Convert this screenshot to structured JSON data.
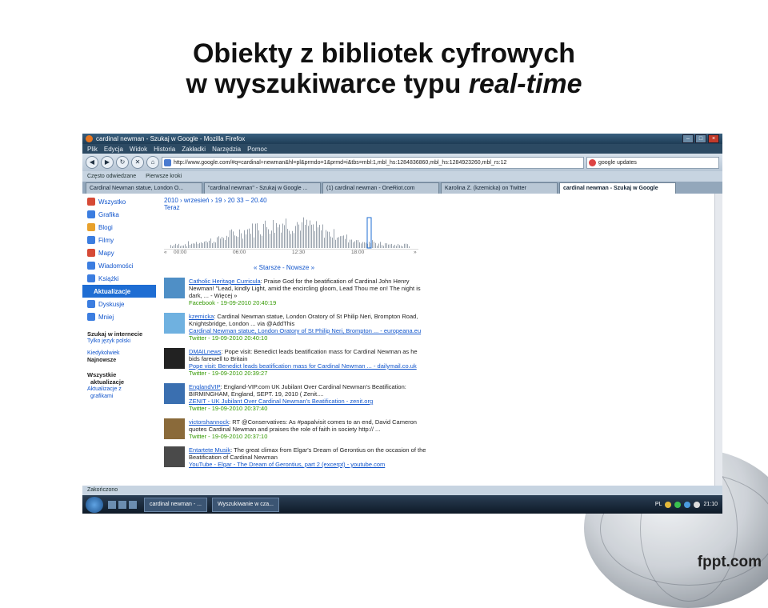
{
  "slide": {
    "title_line1": "Obiekty z bibliotek cyfrowych",
    "title_line2": "w wyszukiwarce typu ",
    "title_italic": "real-time",
    "brand": "fppt.com"
  },
  "browser": {
    "window_title": "cardinal newman - Szukaj w Google - Mozilla Firefox",
    "menu": [
      "Plik",
      "Edycja",
      "Widok",
      "Historia",
      "Zakładki",
      "Narzędzia",
      "Pomoc"
    ],
    "url": "http://www.google.com/#q=cardinal+newman&hl=pl&prmdo=1&prmd=i&tbs=mbl:1,mbl_hs:1284836860,mbl_hs:1284923260,mbl_rs:12",
    "search_value": "google updates",
    "bookmarks": [
      "Często odwiedzane",
      "Pierwsze kroki"
    ],
    "tabs": [
      "Cardinal Newman statue, London O...",
      "\"cardinal newman\" - Szukaj w Google ...",
      "(1) cardinal newman - OneRiot.com",
      "Karolina Z. (kzemicka) on Twitter",
      "cardinal newman - Szukaj w Google"
    ],
    "status": "Zakończono"
  },
  "sidebar": {
    "items": [
      {
        "label": "Wszystko",
        "color": "#d64a36"
      },
      {
        "label": "Grafika",
        "color": "#3b7de0"
      },
      {
        "label": "Blogi",
        "color": "#e8a12c"
      },
      {
        "label": "Filmy",
        "color": "#3b7de0"
      },
      {
        "label": "Mapy",
        "color": "#d64a36"
      },
      {
        "label": "Wiadomości",
        "color": "#3b7de0"
      },
      {
        "label": "Książki",
        "color": "#3b7de0"
      },
      {
        "label": "Aktualizacje",
        "color": "#1e6dd3"
      },
      {
        "label": "Dyskusje",
        "color": "#3b7de0"
      },
      {
        "label": "Mniej",
        "color": "#3b7de0"
      }
    ],
    "search_heading": "Szukaj w internecie",
    "lang_link": "Tylko język polski",
    "when_link": "Kiedykolwiek",
    "newest": "Najnowsze",
    "all_updates_1": "Wszystkie",
    "all_updates_2": "aktualizacje",
    "img_updates_1": "Aktualizacje z",
    "img_updates_2": "grafikami"
  },
  "main": {
    "crumb": "2010 › wrzesień › 19 › 20 33 – 20.40",
    "now": "Teraz",
    "time_labels": [
      "«",
      "00:00",
      "06:00",
      "12:30",
      "18:00",
      "»"
    ],
    "pager": "« Starsze - Nowsze »",
    "results": [
      {
        "thumb_color": "#4f8fc6",
        "title": "Catholic Heritage Curricula",
        "text": ": Praise God for the beatification of Cardinal John Henry Newman! \"Lead, kindly Light, amid the encircling gloom, Lead Thou me on! The night is dark, ... - Więcej »",
        "source": "",
        "meta": "Facebook - 19-09-2010 20:40:19"
      },
      {
        "thumb_color": "#6fb1e0",
        "title": "kzemicka",
        "text": ": Cardinal Newman statue, London Oratory of St Philip Neri, Brompton Road, Knightsbridge, London ... via @AddThis",
        "source": "Cardinal Newman statue, London Oratory of St Philip Neri, Brompton ... - europeana.eu",
        "meta": "Twitter - 19-09-2010 20:40:10"
      },
      {
        "thumb_color": "#222222",
        "title": "DMAILnews",
        "text": ": Pope visit: Benedict leads beatification mass for Cardinal Newman as he bids farewell to Britain",
        "source": "Pope visit: Benedict leads beatification mass for Cardinal Newman ... - dailymail.co.uk",
        "meta": "Twitter - 19-09-2010 20:39:27"
      },
      {
        "thumb_color": "#3a6fb0",
        "title": "EnglandVIP",
        "text": ": England-VIP.com UK Jubilant Over Cardinal Newman's Beatification: BIRMINGHAM, England, SEPT. 19, 2010 ( Zenit....",
        "source": "ZENIT - UK Jubilant Over Cardinal Newman's Beatification - zenit.org",
        "meta": "Twitter - 19-09-2010 20:37:40"
      },
      {
        "thumb_color": "#8a6a3a",
        "title": "victorshannock",
        "text": ": RT @Conservatives: As #papalvisit comes to an end, David Cameron quotes Cardinal Newman and praises the role of faith in society http:// ...",
        "source": "",
        "meta": "Twitter - 19-09-2010 20:37:10"
      },
      {
        "thumb_color": "#4a4a4a",
        "title": "Entartete Musik",
        "text": ": The great climax from Elgar's Dream of Gerontius on the occasion of the Beatification of Cardinal Newman",
        "source": "YouTube - Elgar - The Dream of Gerontius, part 2 (excerpt) - youtube.com",
        "meta": ""
      }
    ]
  },
  "taskbar": {
    "tasks": [
      "cardinal newman - ...",
      "Wyszukiwanie w cza..."
    ],
    "lang": "PL",
    "clock": "21:10"
  }
}
